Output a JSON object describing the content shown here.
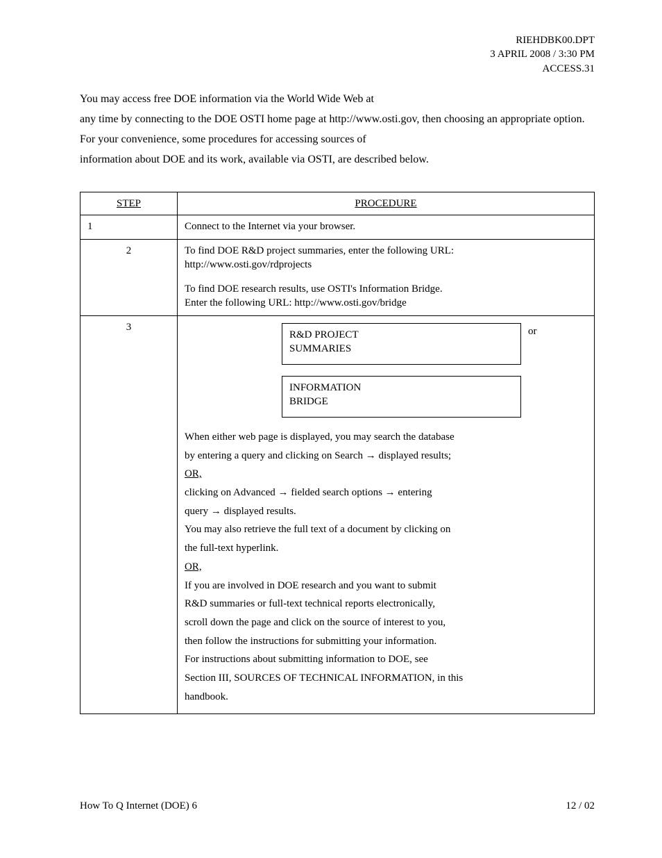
{
  "header": {
    "doc_id": "RIEHDBK00.DPT",
    "date_line": "3 APRIL 2008 / 3:30 PM",
    "page_ref": "ACCESS.31"
  },
  "intro": {
    "line1": "You may access free DOE information via the World Wide Web at",
    "line2_prefix": "any time by connecting to the DOE OSTI home page at ",
    "line2_url": "http://www.osti.gov",
    "line2_suffix": ", then choosing an appropriate option.",
    "line3": "For your convenience, some procedures for accessing sources of",
    "line4": "information about DOE and its work, available via OSTI, are described below."
  },
  "table": {
    "headers": {
      "step": "STEP",
      "procedure": "PROCEDURE"
    },
    "row2": {
      "step": "1",
      "procedure": "Connect to the Internet via your browser."
    },
    "row3": {
      "step": "2",
      "procedure_lines": [
        "To find DOE R&D project summaries, enter the following URL:",
        "http://www.osti.gov/rdprojects",
        "",
        "To find DOE research results, use OSTI's Information Bridge.",
        "Enter the following URL: http://www.osti.gov/bridge"
      ]
    },
    "row4": {
      "step": "3",
      "nav1_line1": "R&D PROJECT",
      "nav1_line2": "SUMMARIES",
      "nav1_right": "or",
      "nav2_line1": "INFORMATION",
      "nav2_line2": "BRIDGE",
      "body": {
        "p1": "When either web page is displayed, you may search the database",
        "p2_pre": "by entering a query and clicking on Search ",
        "p2_post": " displayed results;",
        "or1": "OR,",
        "p3_pre": "clicking on Advanced ",
        "p3_mid": " fielded search options ",
        "p3_post": " entering",
        "p4_pre": "query ",
        "p4_post": " displayed results.",
        "p5": "You may also retrieve the full text of a document by clicking on",
        "p6": "the full-text hyperlink.",
        "or2": "OR,",
        "p7": "If you are involved in DOE research and you want to submit",
        "p8": "R&D summaries or full-text technical reports electronically,",
        "p9": "scroll down the page and click on the source of interest to you,",
        "p10": "then follow the instructions for submitting your information.",
        "p11": "For instructions about submitting information to DOE, see",
        "p12": "Section III, SOURCES OF TECHNICAL INFORMATION, in this",
        "p13": "handbook."
      }
    }
  },
  "footer": {
    "left": "How To Q Internet (DOE) 6",
    "right": "12 / 02"
  }
}
